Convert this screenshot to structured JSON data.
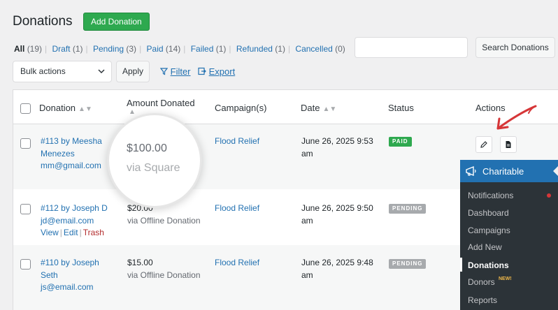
{
  "header": {
    "title": "Donations",
    "add_button": "Add Donation"
  },
  "status_filters": [
    {
      "label": "All",
      "count": "(19)",
      "current": true
    },
    {
      "label": "Draft",
      "count": "(1)"
    },
    {
      "label": "Pending",
      "count": "(3)"
    },
    {
      "label": "Paid",
      "count": "(14)"
    },
    {
      "label": "Failed",
      "count": "(1)"
    },
    {
      "label": "Refunded",
      "count": "(1)"
    },
    {
      "label": "Cancelled",
      "count": "(0)"
    }
  ],
  "search": {
    "value": "",
    "button": "Search Donations"
  },
  "bulk": {
    "select_value": "Bulk actions",
    "apply": "Apply"
  },
  "toolbar": {
    "filter": "Filter",
    "export": "Export"
  },
  "columns": {
    "donation": "Donation",
    "amount": "Amount Donated",
    "campaign": "Campaign(s)",
    "date": "Date",
    "status": "Status",
    "actions": "Actions"
  },
  "rows": [
    {
      "donation_line1": "#113 by Meesha",
      "donation_line2": "Menezes",
      "email": "mm@gmail.com",
      "amount": "$100.00",
      "via": "via Square",
      "campaign": "Flood Relief",
      "date_line1": "June 26, 2025 9:53",
      "date_line2": "am",
      "status": "PAID"
    },
    {
      "donation_line1": "#112 by Joseph D",
      "email": "jd@email.com",
      "amount": "$20.00",
      "via": "via Offline Donation",
      "campaign": "Flood Relief",
      "date_line1": "June 26, 2025 9:50",
      "date_line2": "am",
      "status": "PENDING",
      "row_actions": {
        "view": "View",
        "edit": "Edit",
        "trash": "Trash",
        "sep": "|"
      }
    },
    {
      "donation_line1": "#110 by Joseph",
      "donation_line2": "Seth",
      "email": "js@email.com",
      "amount": "$15.00",
      "via": "via Offline Donation",
      "campaign": "Flood Relief",
      "date_line1": "June 26, 2025 9:48",
      "date_line2": "am",
      "status": "PENDING"
    }
  ],
  "menu": {
    "title": "Charitable",
    "items": [
      "Notifications",
      "Dashboard",
      "Campaigns",
      "Add New",
      "Donations",
      "Donors",
      "Reports"
    ],
    "current": "Donations",
    "new_badge": "NEW!"
  },
  "colors": {
    "accent": "#2271b1",
    "add_button": "#2ea94f",
    "paid": "#2ea94f",
    "pending": "#a7aaad",
    "menu_bg": "#2c3338",
    "arrow": "#d63638"
  },
  "icons": {
    "filter": "funnel-icon",
    "export": "export-icon",
    "edit": "pencil-icon",
    "receipt": "document-icon",
    "sort": "sort-arrows-icon",
    "menu_logo": "megaphone-icon"
  }
}
